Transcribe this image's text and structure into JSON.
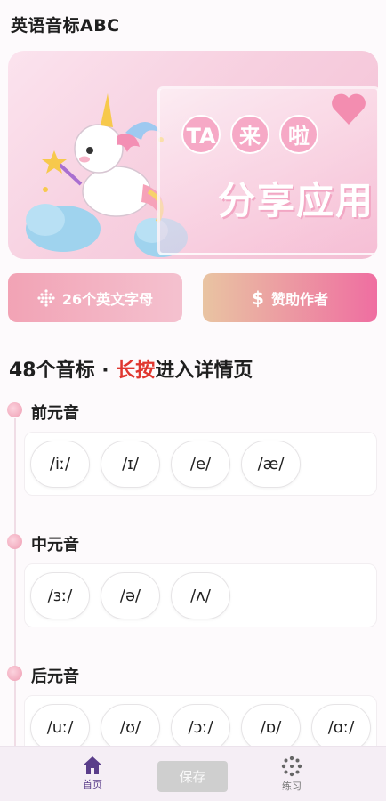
{
  "app": {
    "title": "英语音标ABC"
  },
  "banner": {
    "bubble1": "TA",
    "bubble2": "来",
    "bubble3": "啦",
    "headline": "分享应用"
  },
  "actions": {
    "letters_label": "26个英文字母",
    "sponsor_label": "赞助作者"
  },
  "section": {
    "heading_prefix": "48个音标 · ",
    "heading_accent": "长按",
    "heading_suffix": "进入详情页"
  },
  "groups": [
    {
      "title": "前元音",
      "symbols": [
        "/iː/",
        "/ɪ/",
        "/e/",
        "/æ/"
      ]
    },
    {
      "title": "中元音",
      "symbols": [
        "/ɜː/",
        "/ə/",
        "/ʌ/"
      ]
    },
    {
      "title": "后元音",
      "symbols": [
        "/uː/",
        "/ʊ/",
        "/ɔː/",
        "/ɒ/",
        "/ɑː/"
      ]
    }
  ],
  "tabbar": {
    "home_label": "首页",
    "save_label": "保存",
    "practice_label": "练习"
  },
  "colors": {
    "accent": "#e0362f",
    "tab_active": "#5a3d8a",
    "pink": "#f4a6c2"
  },
  "icons": {
    "letters": "grid-dots-icon",
    "sponsor": "dollar-icon",
    "home": "home-icon",
    "practice": "sparkle-icon"
  }
}
